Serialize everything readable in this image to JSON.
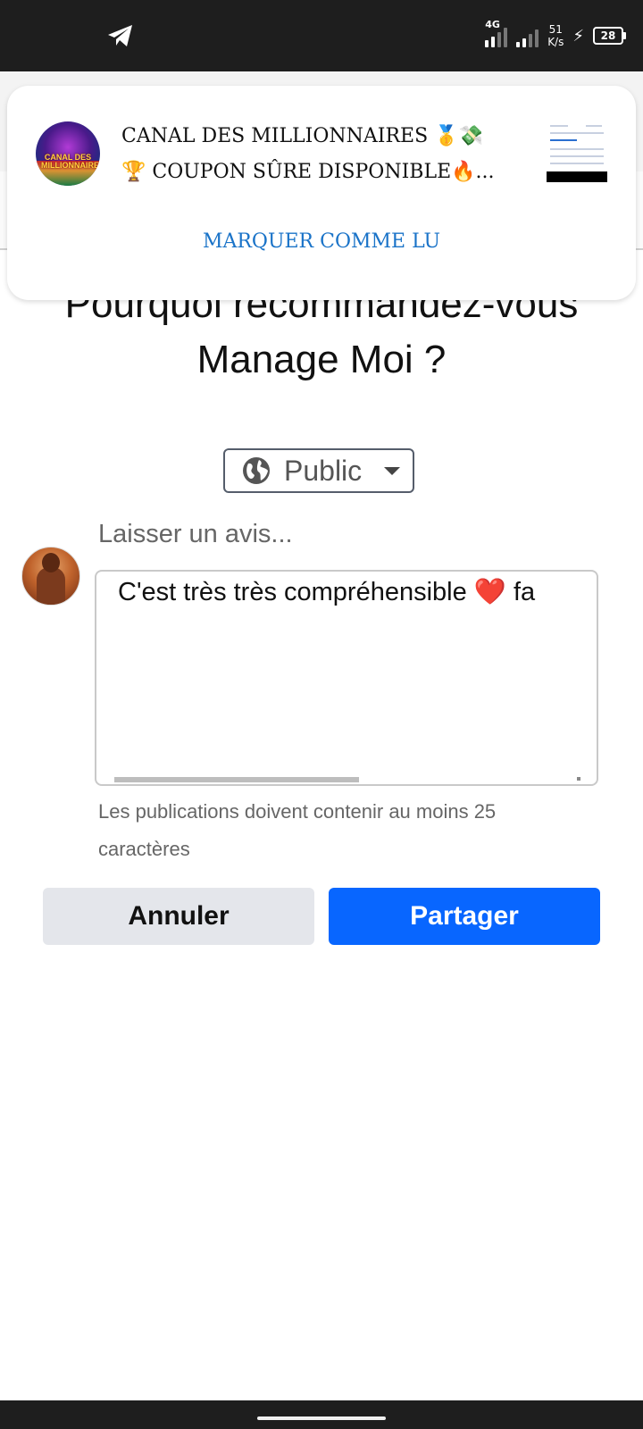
{
  "status_bar": {
    "network_label": "4G",
    "speed_value": "51",
    "speed_unit": "K/s",
    "battery": "28"
  },
  "page": {
    "title_line1": "Pourquoi recommandez-vous",
    "title_line2": "Manage Moi ?"
  },
  "notification": {
    "avatar_text": "CANAL DES MILLIONNAIRES",
    "line1": "CANAL DES MILLIONNAIRES 🥇💸",
    "line2": "🏆 COUPON SÛRE DISPONIBLE🔥...",
    "action_label": "MARQUER COMME LU",
    "action_color": "#1a73c8"
  },
  "audience": {
    "icon": "globe-icon",
    "label": "Public"
  },
  "review": {
    "prompt": "Laisser un avis...",
    "text_before": "C'est très très compréhensible ",
    "heart": "❤️",
    "text_after": " fa",
    "hint": "Les publications doivent contenir au moins 25 caractères"
  },
  "buttons": {
    "cancel_label": "Annuler",
    "share_label": "Partager",
    "share_color": "#0866ff"
  }
}
